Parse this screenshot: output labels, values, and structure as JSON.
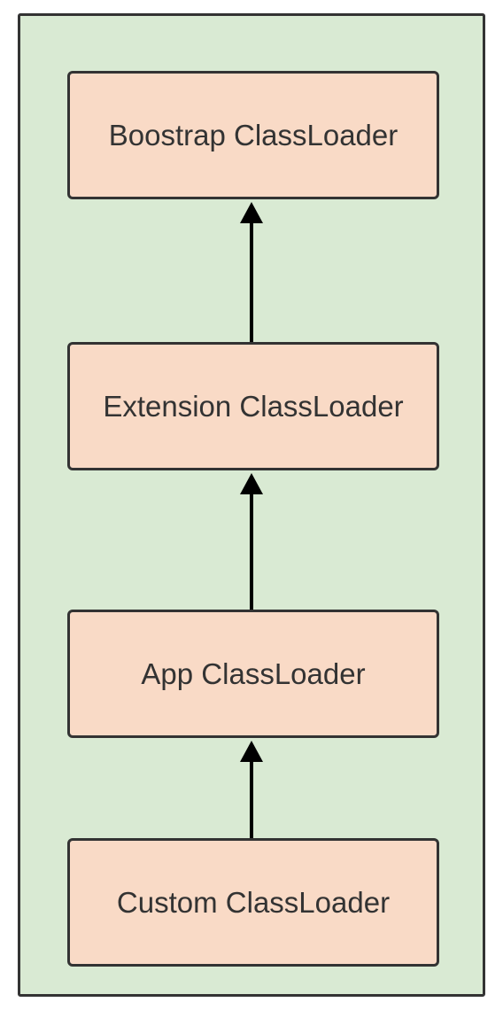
{
  "diagram": {
    "boxes": [
      {
        "label": "Boostrap ClassLoader"
      },
      {
        "label": "Extension ClassLoader"
      },
      {
        "label": "App ClassLoader"
      },
      {
        "label": "Custom ClassLoader"
      }
    ]
  }
}
